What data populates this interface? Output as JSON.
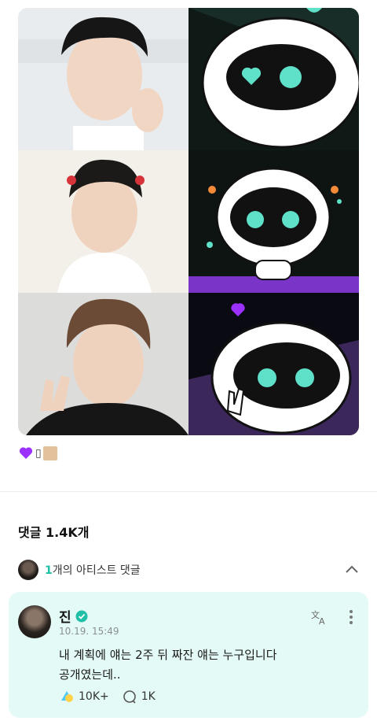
{
  "post": {
    "images": [
      {
        "name": "photo-jin-1",
        "kind": "photo"
      },
      {
        "name": "character-wootteo-1",
        "kind": "illustration"
      },
      {
        "name": "photo-jin-2",
        "kind": "photo"
      },
      {
        "name": "character-wootteo-2",
        "kind": "illustration"
      },
      {
        "name": "photo-jin-3",
        "kind": "photo"
      },
      {
        "name": "character-wootteo-3",
        "kind": "illustration"
      }
    ],
    "caption_glyph": "▯",
    "colors": {
      "purple_heart": "#9b30ff",
      "skin": "#e2c19c"
    }
  },
  "comments": {
    "title": "댓글 1.4K개",
    "artist_count": "1",
    "artist_label": "개의 아티스트 댓글"
  },
  "comment": {
    "author": "진",
    "time": "10.19. 15:49",
    "text": "내 계획에 얘는 2주 뒤 짜잔 얘는 누구입니다\n공개였는데..",
    "likes": "10K+",
    "replies": "1K",
    "accent": "#1fbfa8"
  }
}
